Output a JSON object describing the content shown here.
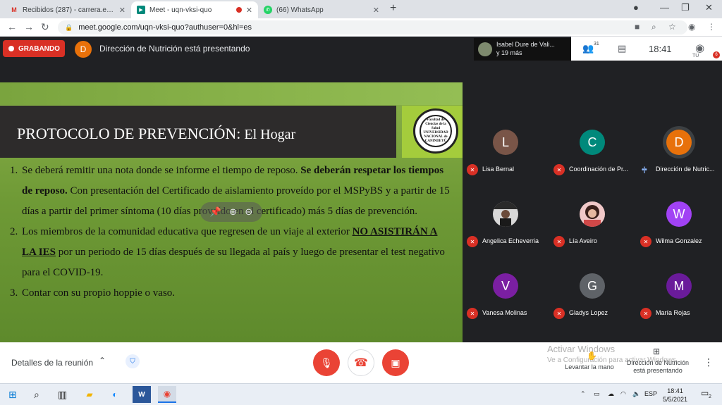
{
  "browser": {
    "tabs": [
      {
        "title": "Recibidos (287) - carrera.enferme",
        "favicon": "gmail-icon",
        "color": "#d93025"
      },
      {
        "title": "Meet - uqn-vksi-quo",
        "favicon": "meet-icon",
        "color": "#00897b"
      },
      {
        "title": "(66) WhatsApp",
        "favicon": "whatsapp-icon",
        "color": "#25d366"
      }
    ],
    "url": "meet.google.com/uqn-vksi-quo?authuser=0&hl=es"
  },
  "meeting": {
    "recording_label": "GRABANDO",
    "presenter_initial": "D",
    "presenter_label": "Dirección de Nutrición está presentando",
    "active_speaker_line1": "Isabel Dure de Vali...",
    "active_speaker_line2": "y 19 más",
    "participant_count": "31",
    "time": "18:41",
    "self_label": "TÚ",
    "self_badge": "6"
  },
  "slide": {
    "title_main": "PROTOCOLO DE PREVENCIÓN:",
    "title_sub": " El Hogar",
    "logo_text": "Facultad de Ciencias de la Salud UNIVERSIDAD NACIONAL de CANINDEYÚ",
    "items": [
      {
        "num": "1.",
        "a": "Se deberá remitir una nota donde se informe el tiempo de reposo. ",
        "b": "Se deberán respetar los tiempos de reposo.",
        "c": " Con presentación del Certificado de aislamiento proveído por el MSPyBS y a partir de 15 días a partir del primer síntoma (10 días proveído en el certificado) más 5 días de prevención."
      },
      {
        "num": "2.",
        "a": "Los miembros de la comunidad educativa que regresen de un viaje al exterior ",
        "b": "NO ASISTIRÁN A LA IES",
        "c": " por un periodo de 15 días después de su llegada al país y luego de presentar el test negativo para el COVID-19."
      },
      {
        "num": "3.",
        "a": "Contar con su propio hoppie o vaso.",
        "b": "",
        "c": ""
      }
    ]
  },
  "participants": [
    {
      "name": "Lisa Bernal",
      "initial": "L",
      "color": "#795548",
      "muted": true
    },
    {
      "name": "Coordinación de Pr...",
      "initial": "C",
      "color": "#00897b",
      "muted": true
    },
    {
      "name": "Dirección de Nutric...",
      "initial": "D",
      "color": "#e8710a",
      "muted": false
    },
    {
      "name": "Angelica Echeverria",
      "initial": "",
      "color": "#444",
      "muted": true
    },
    {
      "name": "Lía Aveiro",
      "initial": "",
      "color": "#c04a4a",
      "muted": true
    },
    {
      "name": "Wilma Gonzalez",
      "initial": "W",
      "color": "#a142f4",
      "muted": true
    },
    {
      "name": "Vanesa Molinas",
      "initial": "V",
      "color": "#7b1fa2",
      "muted": true
    },
    {
      "name": "Gladys Lopez",
      "initial": "G",
      "color": "#5f6368",
      "muted": true
    },
    {
      "name": "María Rojas",
      "initial": "M",
      "color": "#6a1b9a",
      "muted": true
    }
  ],
  "bottom": {
    "details_label": "Detalles de la reunión",
    "watermark_title": "Activar Windows",
    "watermark_sub": "Ve a Configuración para activar Windows.",
    "raise_hand_label": "Levantar la mano",
    "presenting_line1": "Dirección de Nutrición",
    "presenting_line2": "está presentando"
  },
  "taskbar": {
    "lang": "ESP",
    "time": "18:41",
    "date": "5/5/2021",
    "notif_count": "2"
  }
}
